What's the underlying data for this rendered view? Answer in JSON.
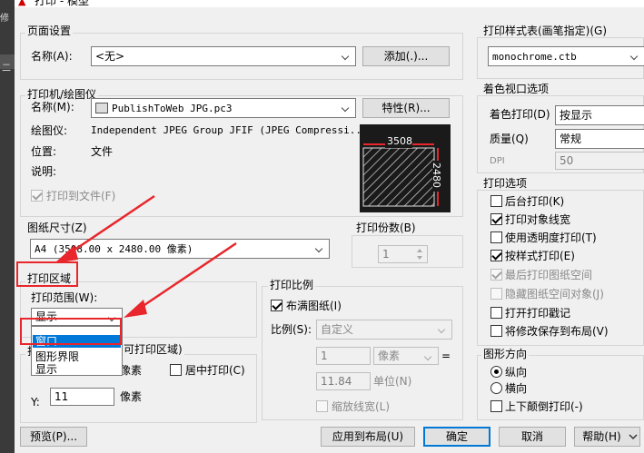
{
  "window": {
    "title": "打印 - 模型",
    "left_partial": "修",
    "left_partial2": "二"
  },
  "page_setup": {
    "group_label": "页面设置",
    "name_label": "名称(A):",
    "name_value": "<无>",
    "add_button": "添加(.)..."
  },
  "printer": {
    "group_label": "打印机/绘图仪",
    "name_label": "名称(M):",
    "name_value": "PublishToWeb JPG.pc3",
    "properties_button": "特性(R)...",
    "plotter_label": "绘图仪:",
    "plotter_value": "Independent JPEG Group JFIF (JPEG Compressi...",
    "location_label": "位置:",
    "location_value": "文件",
    "description_label": "说明:",
    "print_to_file_label": "打印到文件(F)",
    "print_to_file_checked": true,
    "preview_width": "3508",
    "preview_height": "2480"
  },
  "paper_size": {
    "group_label": "图纸尺寸(Z)",
    "value": "A4 (3508.00 x 2480.00 像素)"
  },
  "copies": {
    "label": "打印份数(B)",
    "value": "1"
  },
  "plot_area": {
    "group_label": "打印区域",
    "range_label": "打印范围(W):",
    "range_value": "显示",
    "dropdown_options": [
      "窗口",
      "图形界限",
      "显示"
    ],
    "selected_option": "窗口"
  },
  "offset": {
    "group_label_partial": "可打印区域)",
    "group_label_visible_start": "打",
    "x_unit": "像素",
    "center_label": "居中打印(C)",
    "y_label": "Y:",
    "y_value": "11",
    "y_unit": "像素"
  },
  "plot_scale": {
    "group_label": "打印比例",
    "fit_label": "布满图纸(I)",
    "fit_checked": true,
    "scale_label": "比例(S):",
    "scale_value": "自定义",
    "value1": "1",
    "unit_value": "像素",
    "equals": "=",
    "value2": "11.84",
    "unit_label": "单位(N)",
    "lineweights_label": "缩放线宽(L)"
  },
  "plot_style_table": {
    "group_label": "打印样式表(画笔指定)(G)",
    "value": "monochrome.ctb"
  },
  "shaded_viewport": {
    "group_label": "着色视口选项",
    "shade_label": "着色打印(D)",
    "shade_value": "按显示",
    "quality_label": "质量(Q)",
    "quality_value": "常规",
    "dpi_label": "DPI",
    "dpi_value": "50"
  },
  "plot_options": {
    "group_label": "打印选项",
    "items": [
      {
        "label": "后台打印(K)",
        "checked": false,
        "disabled": false
      },
      {
        "label": "打印对象线宽",
        "checked": true,
        "disabled": false
      },
      {
        "label": "使用透明度打印(T)",
        "checked": false,
        "disabled": false
      },
      {
        "label": "按样式打印(E)",
        "checked": true,
        "disabled": false
      },
      {
        "label": "最后打印图纸空间",
        "checked": true,
        "disabled": true
      },
      {
        "label": "隐藏图纸空间对象(J)",
        "checked": false,
        "disabled": true
      },
      {
        "label": "打开打印戳记",
        "checked": false,
        "disabled": false
      },
      {
        "label": "将修改保存到布局(V)",
        "checked": false,
        "disabled": false
      }
    ]
  },
  "orientation": {
    "group_label": "图形方向",
    "portrait": "纵向",
    "landscape": "横向",
    "upside_down": "上下颠倒打印(-)",
    "selected": "portrait"
  },
  "footer": {
    "preview_button": "预览(P)...",
    "apply_button": "应用到布局(U)",
    "ok_button": "确定",
    "cancel_button": "取消",
    "help_button": "帮助(H)"
  },
  "colors": {
    "annotation_red": "#e8262b",
    "selection_blue": "#0078d7"
  }
}
